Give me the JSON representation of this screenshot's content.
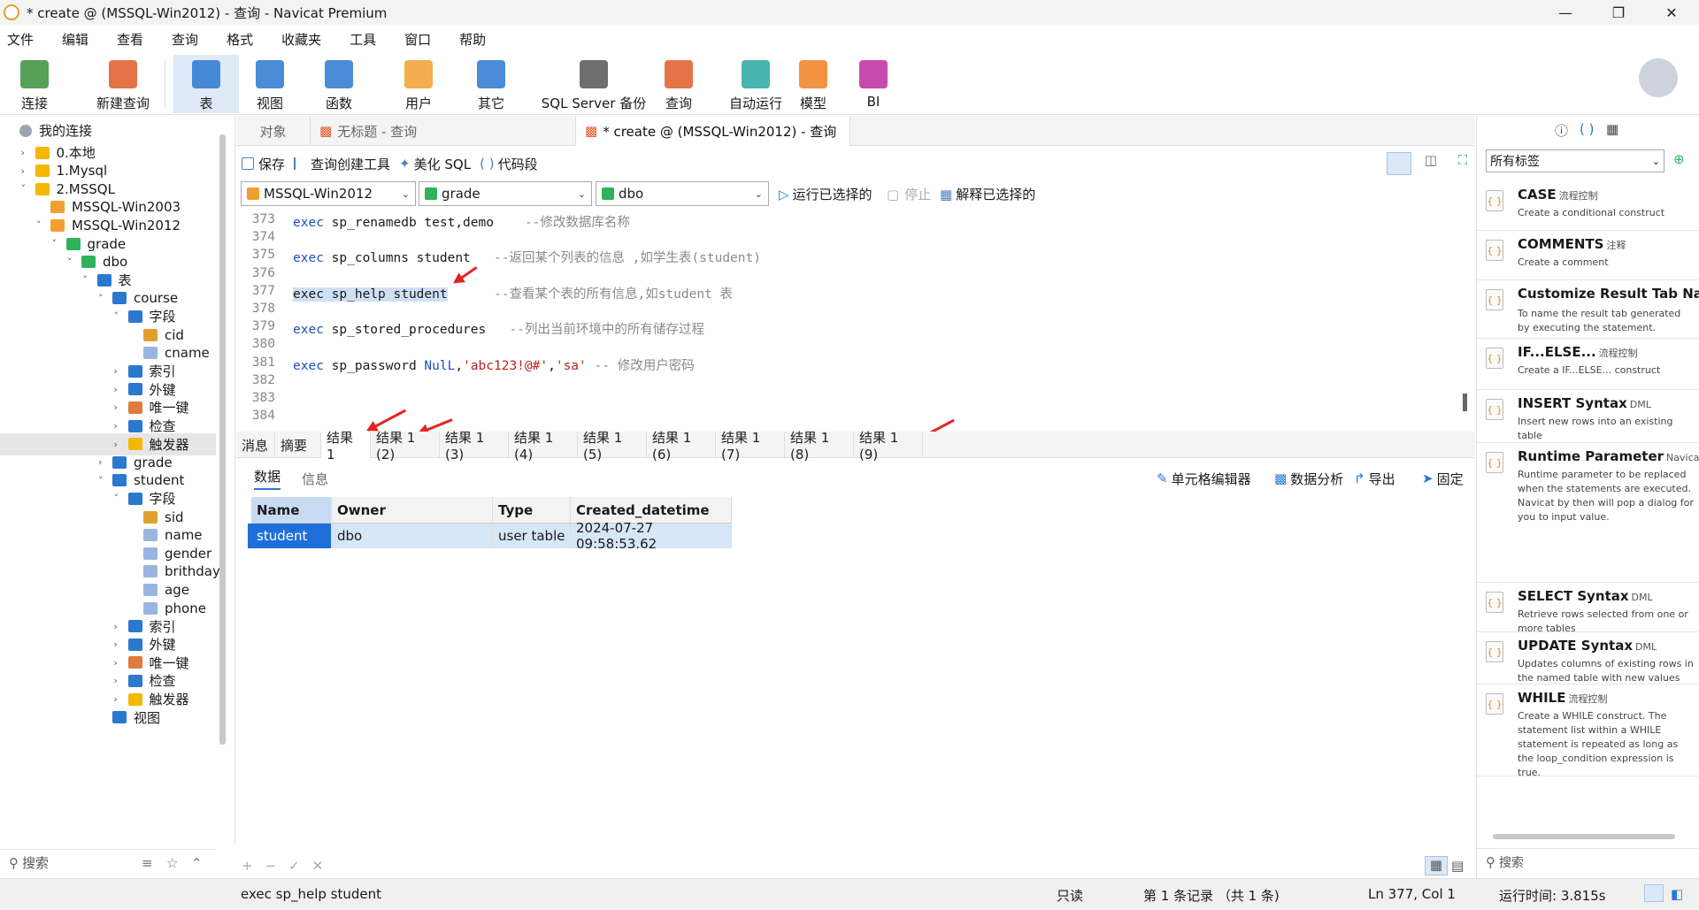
{
  "window": {
    "title": "* create @ (MSSQL-Win2012) - 查询 - Navicat Premium"
  },
  "menu": [
    "文件",
    "编辑",
    "查看",
    "查询",
    "格式",
    "收藏夹",
    "工具",
    "窗口",
    "帮助"
  ],
  "toolbar": [
    {
      "label": "连接",
      "icon": "connect-icon",
      "color": "#3a8f3a"
    },
    {
      "label": "新建查询",
      "icon": "new-query-icon",
      "color": "#e05a2a"
    },
    {
      "label": "表",
      "icon": "table-icon",
      "color": "#2a78d0"
    },
    {
      "label": "视图",
      "icon": "view-icon",
      "color": "#2a78d0"
    },
    {
      "label": "函数",
      "icon": "function-icon",
      "color": "#2a78d0"
    },
    {
      "label": "用户",
      "icon": "user-icon",
      "color": "#f0a030"
    },
    {
      "label": "其它",
      "icon": "tools-icon",
      "color": "#2a78d0"
    },
    {
      "label": "SQL Server 备份",
      "icon": "backup-icon",
      "color": "#555555"
    },
    {
      "label": "查询",
      "icon": "query-icon",
      "color": "#e05a2a"
    },
    {
      "label": "自动运行",
      "icon": "robot-icon",
      "color": "#2aa7a0"
    },
    {
      "label": "模型",
      "icon": "model-icon",
      "color": "#f08020"
    },
    {
      "label": "BI",
      "icon": "bi-icon",
      "color": "#c02aa0"
    }
  ],
  "tree": {
    "header": "我的连接",
    "items": [
      {
        "label": "0.本地",
        "type": "folder"
      },
      {
        "label": "1.Mysql",
        "type": "folder"
      },
      {
        "label": "2.MSSQL",
        "type": "folder"
      },
      {
        "label": "MSSQL-Win2003",
        "type": "server"
      },
      {
        "label": "MSSQL-Win2012",
        "type": "server"
      },
      {
        "label": "grade",
        "type": "database"
      },
      {
        "label": "dbo",
        "type": "schema"
      },
      {
        "label": "表",
        "type": "tables"
      },
      {
        "label": "course",
        "type": "table"
      },
      {
        "label": "字段",
        "type": "fields"
      },
      {
        "label": "cid",
        "type": "key"
      },
      {
        "label": "cname",
        "type": "column"
      },
      {
        "label": "索引",
        "type": "index"
      },
      {
        "label": "外键",
        "type": "fk"
      },
      {
        "label": "唯一键",
        "type": "unique"
      },
      {
        "label": "检查",
        "type": "check"
      },
      {
        "label": "触发器",
        "type": "trigger"
      },
      {
        "label": "grade",
        "type": "table"
      },
      {
        "label": "student",
        "type": "table"
      },
      {
        "label": "字段",
        "type": "fields"
      },
      {
        "label": "sid",
        "type": "key"
      },
      {
        "label": "name",
        "type": "column"
      },
      {
        "label": "gender",
        "type": "column"
      },
      {
        "label": "brithday",
        "type": "column"
      },
      {
        "label": "age",
        "type": "column"
      },
      {
        "label": "phone",
        "type": "column"
      },
      {
        "label": "索引",
        "type": "index"
      },
      {
        "label": "外键",
        "type": "fk"
      },
      {
        "label": "唯一键",
        "type": "unique"
      },
      {
        "label": "检查",
        "type": "check"
      },
      {
        "label": "触发器",
        "type": "trigger"
      },
      {
        "label": "视图",
        "type": "views"
      }
    ],
    "search_placeholder": "搜索"
  },
  "tabs": [
    {
      "label": "对象"
    },
    {
      "label": "无标题 - 查询"
    },
    {
      "label": "* create @ (MSSQL-Win2012) - 查询"
    }
  ],
  "query_toolbar": {
    "save": "保存",
    "builder": "查询创建工具",
    "beautify": "美化 SQL",
    "snippet": "代码段"
  },
  "selectors": {
    "connection": "MSSQL-Win2012",
    "database": "grade",
    "schema": "dbo",
    "run_selected": "运行已选择的",
    "stop": "停止",
    "explain": "解释已选择的"
  },
  "editor": {
    "lines": [
      {
        "n": "373",
        "parts": [
          {
            "t": "exec",
            "c": "kw"
          },
          {
            "t": " sp_renamedb test,demo    ",
            "c": ""
          },
          {
            "t": "--修改数据库名称",
            "c": "cm"
          }
        ]
      },
      {
        "n": "374",
        "parts": []
      },
      {
        "n": "375",
        "parts": [
          {
            "t": "exec",
            "c": "kw"
          },
          {
            "t": " sp_columns student   ",
            "c": ""
          },
          {
            "t": "--返回某个列表的信息 ,如学生表(student)",
            "c": "cm"
          }
        ]
      },
      {
        "n": "376",
        "parts": []
      },
      {
        "n": "377",
        "parts": [
          {
            "t": "exec sp_help student",
            "c": "hl"
          },
          {
            "t": "      ",
            "c": ""
          },
          {
            "t": "--查看某个表的所有信息,如student 表",
            "c": "cm"
          }
        ]
      },
      {
        "n": "378",
        "parts": []
      },
      {
        "n": "379",
        "parts": [
          {
            "t": "exec",
            "c": "kw"
          },
          {
            "t": " sp_stored_procedures   ",
            "c": ""
          },
          {
            "t": "--列出当前环境中的所有储存过程",
            "c": "cm"
          }
        ]
      },
      {
        "n": "380",
        "parts": []
      },
      {
        "n": "381",
        "parts": [
          {
            "t": "exec",
            "c": "kw"
          },
          {
            "t": " sp_password ",
            "c": ""
          },
          {
            "t": "NulL",
            "c": "kw"
          },
          {
            "t": ",",
            "c": ""
          },
          {
            "t": "'abc123!@#'",
            "c": "st"
          },
          {
            "t": ",",
            "c": ""
          },
          {
            "t": "'sa'",
            "c": "st"
          },
          {
            "t": " ",
            "c": ""
          },
          {
            "t": "-- 修改用户密码",
            "c": "cm"
          }
        ]
      },
      {
        "n": "382",
        "parts": []
      },
      {
        "n": "383",
        "parts": []
      },
      {
        "n": "384",
        "parts": []
      }
    ]
  },
  "result_tabs": [
    "消息",
    "摘要",
    "结果 1",
    "结果 1 (2)",
    "结果 1 (3)",
    "结果 1 (4)",
    "结果 1 (5)",
    "结果 1 (6)",
    "结果 1 (7)",
    "结果 1 (8)",
    "结果 1 (9)"
  ],
  "sub_tabs": {
    "data": "数据",
    "info": "信息",
    "cell_editor": "单元格编辑器",
    "analyze": "数据分析",
    "export": "导出",
    "pin": "固定"
  },
  "grid": {
    "columns": [
      "Name",
      "Owner",
      "Type",
      "Created_datetime"
    ],
    "rows": [
      [
        "student",
        "dbo",
        "user table",
        "2024-07-27 09:58:53.62"
      ]
    ]
  },
  "status": {
    "sql": "exec sp_help student",
    "readonly": "只读",
    "records": "第 1 条记录 （共 1 条)",
    "position": "Ln 377, Col 1",
    "runtime": "运行时间: 3.815s"
  },
  "right_panel": {
    "tag_select": "所有标签",
    "search_placeholder": "搜索",
    "snippets": [
      {
        "title": "CASE",
        "tag": "流程控制",
        "desc": "Create a conditional construct"
      },
      {
        "title": "COMMENTS",
        "tag": "注释",
        "desc": "Create a comment"
      },
      {
        "title": "Customize Result Tab Na",
        "tag": "",
        "desc": "To name the result tab generated by executing the statement."
      },
      {
        "title": "IF...ELSE...",
        "tag": "流程控制",
        "desc": "Create a IF...ELSE... construct"
      },
      {
        "title": "INSERT Syntax",
        "tag": "DML",
        "desc": "Insert new rows into an existing table"
      },
      {
        "title": "Runtime Parameter",
        "tag": "Navicat",
        "desc": "Runtime parameter to be replaced when the statements are executed. Navicat by then will pop a dialog for you to input value."
      },
      {
        "title": "SELECT Syntax",
        "tag": "DML",
        "desc": "Retrieve rows selected from one or more tables"
      },
      {
        "title": "UPDATE Syntax",
        "tag": "DML",
        "desc": "Updates columns of existing rows in the named table with new values"
      },
      {
        "title": "WHILE",
        "tag": "流程控制",
        "desc": "Create a WHILE construct. The statement list within a WHILE statement is repeated as long as the loop_condition expression is true."
      }
    ]
  }
}
